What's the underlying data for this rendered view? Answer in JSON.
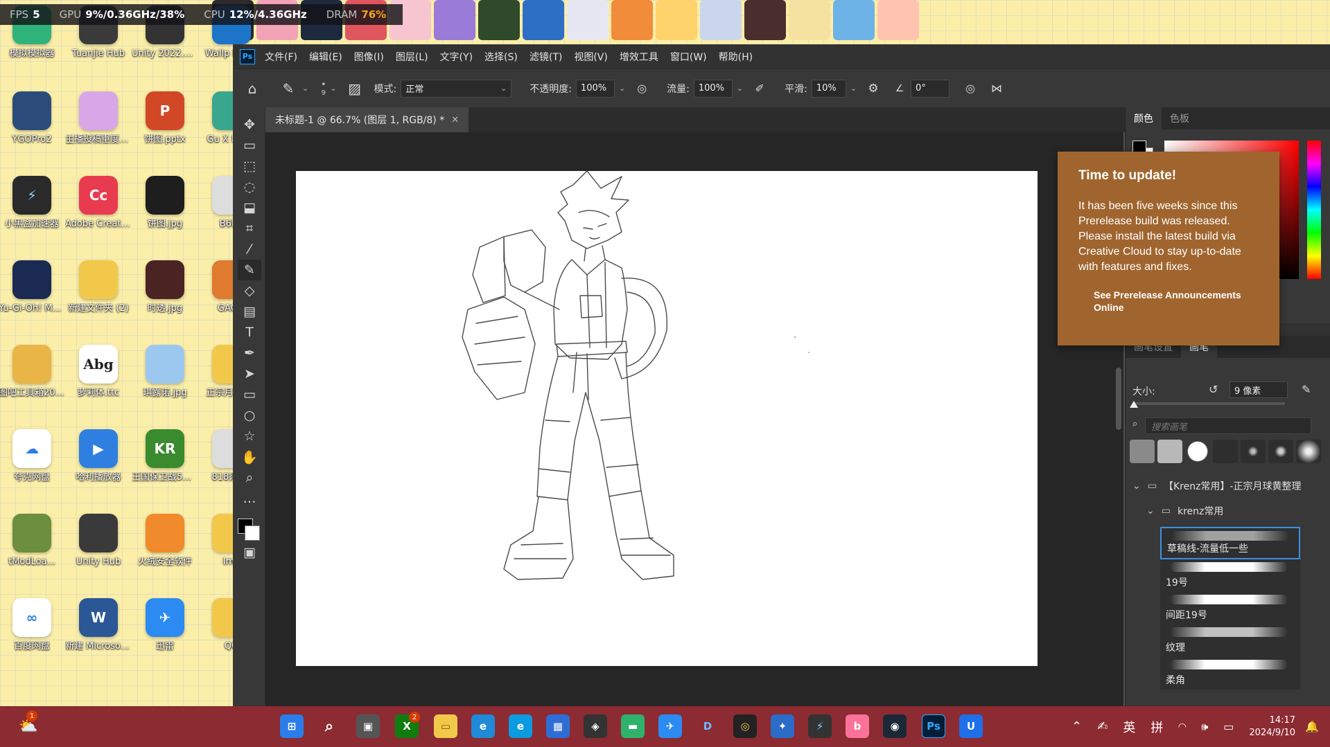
{
  "perf": {
    "fps_label": "FPS",
    "fps_value": "5",
    "gpu_label": "GPU",
    "gpu_value": "9%/0.36GHz/38%",
    "cpu_label": "CPU",
    "cpu_value": "12%/4.36GHz",
    "dram_label": "DRAM",
    "dram_value": "76%"
  },
  "desktop_icons": [
    "模拟模拟器",
    "Tuanjie Hub",
    "Unity 2022.3.34...",
    "Wallp Engin",
    "YGOPro2",
    "主播投稿重度依赖",
    "饼图.pptx",
    "Gu X Fanta",
    "小黑盒加速器",
    "Adobe Creati...",
    "饼图.jpg",
    "B6FH",
    "Yu-Gi-Oh! Master Duel",
    "新建文件夹 (2)",
    "时透.jpg",
    "GAOM",
    "图吧工具箱2024",
    "萝莉体.ttc",
    "琪露诺.jpg",
    "正宗月 Kren",
    "夸克网盘",
    "哈利播放器",
    "王国保卫战5：联盟",
    "818须 ps",
    "tModLoa...",
    "Unity Hub",
    "火绒安全软件",
    "Ima",
    "百度网盘",
    "新建 Microsoft...",
    "迅雷",
    "QQ"
  ],
  "menu": [
    "文件(F)",
    "编辑(E)",
    "图像(I)",
    "图层(L)",
    "文字(Y)",
    "选择(S)",
    "滤镜(T)",
    "视图(V)",
    "增效工具",
    "窗口(W)",
    "帮助(H)"
  ],
  "options": {
    "brush_size": "9",
    "mode_label": "模式:",
    "mode_value": "正常",
    "opacity_label": "不透明度:",
    "opacity_value": "100%",
    "flow_label": "流量:",
    "flow_value": "100%",
    "smooth_label": "平滑:",
    "smooth_value": "10%",
    "angle_value": "0°"
  },
  "document": {
    "tab_title": "未标题-1 @ 66.7% (图层 1, RGB/8) *"
  },
  "popup": {
    "title": "Time to update!",
    "body": "It has been five weeks since this Prerelease build was released. Please install the latest build via Creative Cloud to stay up-to-date with features and fixes.",
    "link": "See Prerelease Announcements Online"
  },
  "color_panel": {
    "tab_color": "颜色",
    "tab_swatches": "色板"
  },
  "brush_panel": {
    "tab_settings": "画笔设置",
    "tab_brushes": "画笔",
    "size_label": "大小:",
    "size_value": "9 像素",
    "search_placeholder": "搜索画笔",
    "group_name": "【Krenz常用】-正宗月球黄整理",
    "subgroup_name": "krenz常用",
    "brushes": [
      "草稿线-流量低一些",
      "19号",
      "间距19号",
      "纹理",
      "柔角"
    ]
  },
  "taskbar": {
    "weather_badge": "1",
    "xbox_badge": "2",
    "ime_lang": "英",
    "ime_mode": "拼",
    "time": "14:17",
    "date": "2024/9/10"
  },
  "colors": {
    "ps_bg": "#535353",
    "popup": "#a0652e",
    "taskbar": "#8c2b32",
    "accent": "#3d8fe2"
  }
}
